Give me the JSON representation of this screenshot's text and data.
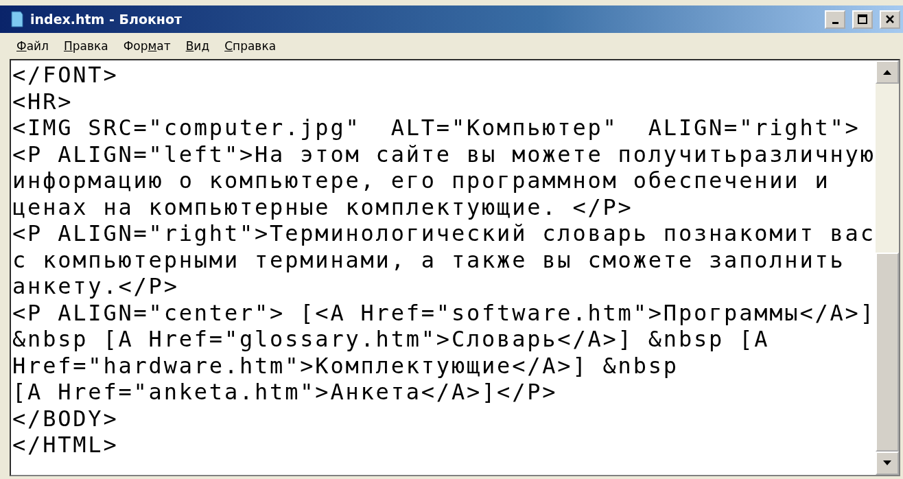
{
  "window": {
    "title": "index.htm - Блокнот"
  },
  "menu": [
    {
      "key": "Ф",
      "after": "айл"
    },
    {
      "key": "П",
      "after": "равка"
    },
    {
      "before": "Фор",
      "key": "м",
      "after": "ат"
    },
    {
      "key": "В",
      "after": "ид"
    },
    {
      "key": "С",
      "after": "правка"
    }
  ],
  "editor": {
    "lines": [
      "</FONT>",
      "<HR>",
      "<IMG SRC=\"computer.jpg\"  ALT=\"Компьютер\"  ALIGN=\"right\">",
      "<P ALIGN=\"left\">На этом сайте вы можете получитьразличную",
      "информацию о компьютере, его программном обеспечении и",
      "ценах на компьютерные комплектующие. </P>",
      "<P ALIGN=\"right\">Терминологический словарь познакомит вас",
      "с компьютерными терминами, а также вы сможете заполнить",
      "анкету.</P>",
      "<P ALIGN=\"center\"> [<A Href=\"software.htm\">Программы</A>]",
      "&nbsp [A Href=\"glossary.htm\">Словарь</A>] &nbsp [A",
      "Href=\"hardware.htm\">Комплектующие</A>] &nbsp",
      "[A Href=\"anketa.htm\">Анкета</A>]</P>",
      "</BODY>",
      "</HTML>"
    ]
  }
}
